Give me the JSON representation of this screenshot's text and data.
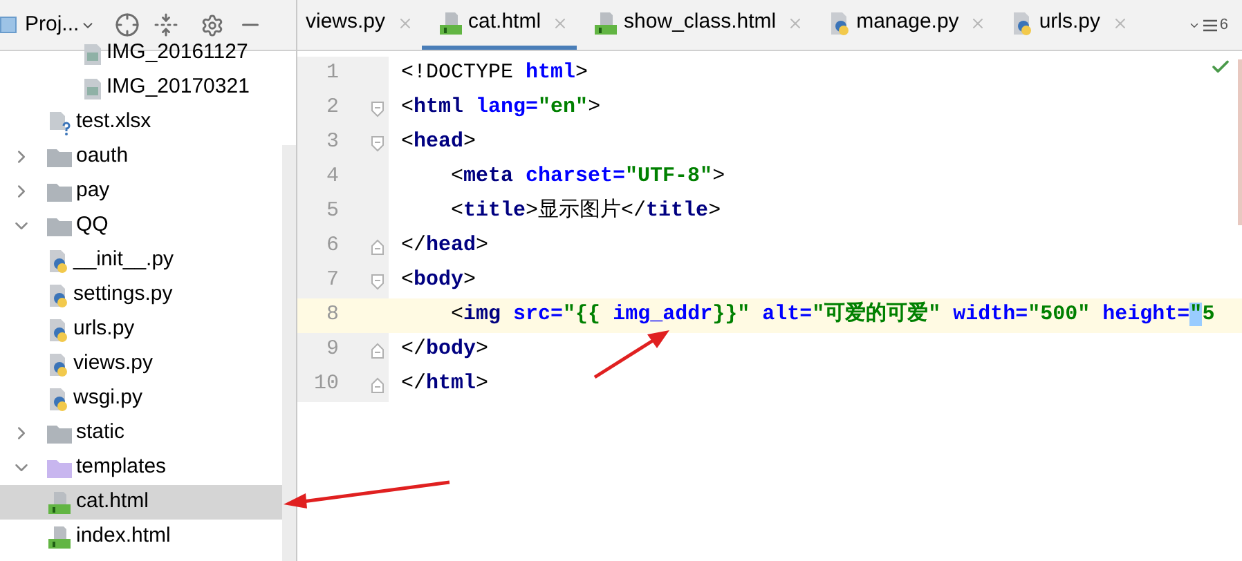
{
  "project_toolbar": {
    "title": "Proj..."
  },
  "tree": [
    {
      "children": [
        {
          "children": [
            {
              "label": "IMG_20161127",
              "kind": "image"
            },
            {
              "label": "IMG_20170321",
              "kind": "image"
            }
          ]
        },
        {
          "label": "test.xlsx",
          "kind": "unknown"
        }
      ]
    },
    {
      "label": "oauth",
      "kind": "folder",
      "expanded": false,
      "selected": false
    },
    {
      "label": "pay",
      "kind": "folder",
      "expanded": false,
      "selected": false
    },
    {
      "label": "QQ",
      "kind": "folder",
      "expanded": true,
      "selected": false,
      "children": [
        {
          "label": "__init__.py",
          "kind": "python",
          "selected": false
        },
        {
          "label": "settings.py",
          "kind": "python",
          "selected": false
        },
        {
          "label": "urls.py",
          "kind": "python",
          "selected": false
        },
        {
          "label": "views.py",
          "kind": "python",
          "selected": false
        },
        {
          "label": "wsgi.py",
          "kind": "python",
          "selected": false
        }
      ]
    },
    {
      "label": "static",
      "kind": "folder",
      "expanded": false,
      "selected": false
    },
    {
      "label": "templates",
      "kind": "template_folder",
      "expanded": true,
      "selected": false,
      "children": [
        {
          "label": "cat.html",
          "kind": "html",
          "selected": true
        },
        {
          "label": "index.html",
          "kind": "html",
          "selected": false
        }
      ]
    }
  ],
  "tabs": [
    {
      "label": "views.py",
      "kind": "none",
      "selected": false
    },
    {
      "label": "cat.html",
      "kind": "html",
      "selected": true
    },
    {
      "label": "show_class.html",
      "kind": "html",
      "selected": false
    },
    {
      "label": "manage.py",
      "kind": "python",
      "selected": false
    },
    {
      "label": "urls.py",
      "kind": "python",
      "selected": false
    }
  ],
  "hidden_tabs_count": "6",
  "editor": {
    "lines": [
      {
        "number": "1",
        "kind": "plain",
        "current": false,
        "indented": false,
        "tokens": [
          {
            "kind": "text",
            "text": "<!DOCTYPE "
          },
          {
            "kind": "attr",
            "text": "html"
          },
          {
            "kind": "text",
            "text": ">"
          }
        ]
      },
      {
        "number": "2",
        "kind": "fold_open",
        "current": false,
        "indented": false,
        "tokens": [
          {
            "kind": "text",
            "text": "<"
          },
          {
            "kind": "tag",
            "text": "html "
          },
          {
            "kind": "attr",
            "text": "lang="
          },
          {
            "kind": "str",
            "text": "\"en\""
          },
          {
            "kind": "text",
            "text": ">"
          }
        ]
      },
      {
        "number": "3",
        "kind": "fold_open",
        "current": false,
        "indented": false,
        "tokens": [
          {
            "kind": "text",
            "text": "<"
          },
          {
            "kind": "tag",
            "text": "head"
          },
          {
            "kind": "text",
            "text": ">"
          }
        ]
      },
      {
        "number": "4",
        "kind": "plain",
        "current": false,
        "indented": true,
        "tokens": [
          {
            "kind": "text",
            "text": "<"
          },
          {
            "kind": "tag",
            "text": "meta "
          },
          {
            "kind": "attr",
            "text": "charset="
          },
          {
            "kind": "str",
            "text": "\"UTF-8\""
          },
          {
            "kind": "text",
            "text": ">"
          }
        ]
      },
      {
        "number": "5",
        "kind": "plain",
        "current": false,
        "indented": true,
        "tokens": [
          {
            "kind": "text",
            "text": "<"
          },
          {
            "kind": "tag",
            "text": "title"
          },
          {
            "kind": "text",
            "text": ">显示图片</"
          },
          {
            "kind": "tag",
            "text": "title"
          },
          {
            "kind": "text",
            "text": ">"
          }
        ]
      },
      {
        "number": "6",
        "kind": "fold_close",
        "current": false,
        "indented": false,
        "tokens": [
          {
            "kind": "text",
            "text": "</"
          },
          {
            "kind": "tag",
            "text": "head"
          },
          {
            "kind": "text",
            "text": ">"
          }
        ]
      },
      {
        "number": "7",
        "kind": "fold_open",
        "current": false,
        "indented": false,
        "tokens": [
          {
            "kind": "text",
            "text": "<"
          },
          {
            "kind": "tag",
            "text": "body"
          },
          {
            "kind": "text",
            "text": ">"
          }
        ]
      },
      {
        "number": "8",
        "kind": "plain",
        "current": true,
        "indented": true,
        "tokens": [
          {
            "kind": "text",
            "text": "<"
          },
          {
            "kind": "tag",
            "text": "img "
          },
          {
            "kind": "attr",
            "text": "src="
          },
          {
            "kind": "str",
            "text": "\"{{ "
          },
          {
            "kind": "attr",
            "text": "img_addr"
          },
          {
            "kind": "str",
            "text": "}}\" "
          },
          {
            "kind": "attr",
            "text": "alt="
          },
          {
            "kind": "str",
            "text": "\"可爱的可爱\" "
          },
          {
            "kind": "attr",
            "text": "width="
          },
          {
            "kind": "str",
            "text": "\"500\" "
          },
          {
            "kind": "attr",
            "text": "height="
          },
          {
            "kind": "match",
            "text": "\""
          },
          {
            "kind": "str",
            "text": "5"
          }
        ]
      },
      {
        "number": "9",
        "kind": "fold_close",
        "current": false,
        "indented": false,
        "tokens": [
          {
            "kind": "text",
            "text": "</"
          },
          {
            "kind": "tag",
            "text": "body"
          },
          {
            "kind": "text",
            "text": ">"
          }
        ]
      },
      {
        "number": "10",
        "kind": "fold_close",
        "current": false,
        "indented": false,
        "tokens": [
          {
            "kind": "text",
            "text": "</"
          },
          {
            "kind": "tag",
            "text": "html"
          },
          {
            "kind": "text",
            "text": ">"
          }
        ]
      }
    ]
  }
}
